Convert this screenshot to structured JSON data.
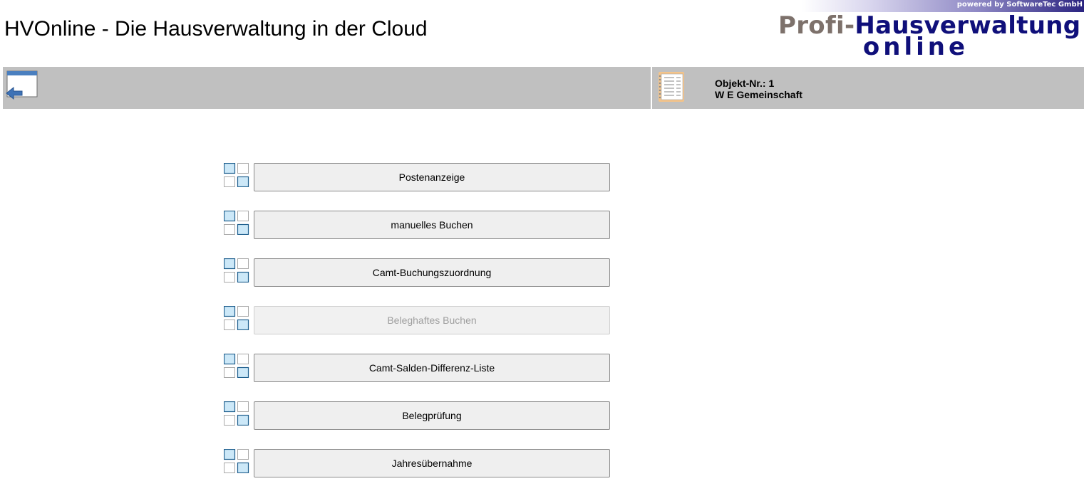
{
  "header": {
    "title": "HVOnline - Die Hausverwaltung in der Cloud"
  },
  "logo": {
    "powered_by": "powered by SoftwareTec GmbH",
    "brand_part1": "Profi-",
    "brand_part2": "Hausverwaltung",
    "brand_sub": "online"
  },
  "object": {
    "number_label": "Objekt-Nr.: 1",
    "name": "W E Gemeinschaft"
  },
  "menu": {
    "items": [
      {
        "label": "Postenanzeige",
        "enabled": true
      },
      {
        "label": "manuelles Buchen",
        "enabled": true
      },
      {
        "label": "Camt-Buchungszuordnung",
        "enabled": true
      },
      {
        "label": "Beleghaftes Buchen",
        "enabled": false
      },
      {
        "label": "Camt-Salden-Differenz-Liste",
        "enabled": true
      },
      {
        "label": "Belegprüfung",
        "enabled": true
      },
      {
        "label": "Jahresübernahme",
        "enabled": true
      }
    ]
  },
  "colors": {
    "toolbar_bg": "#c0c0c0",
    "icon_blue_fill": "#cce8f8",
    "icon_blue_border": "#1f5f8e",
    "logo_gray": "#7d716b",
    "logo_navy": "#0f0f7a"
  },
  "icons": {
    "back": "window-back-arrow-icon",
    "object": "notebook-list-icon",
    "menu": "grid-squares-icon"
  }
}
